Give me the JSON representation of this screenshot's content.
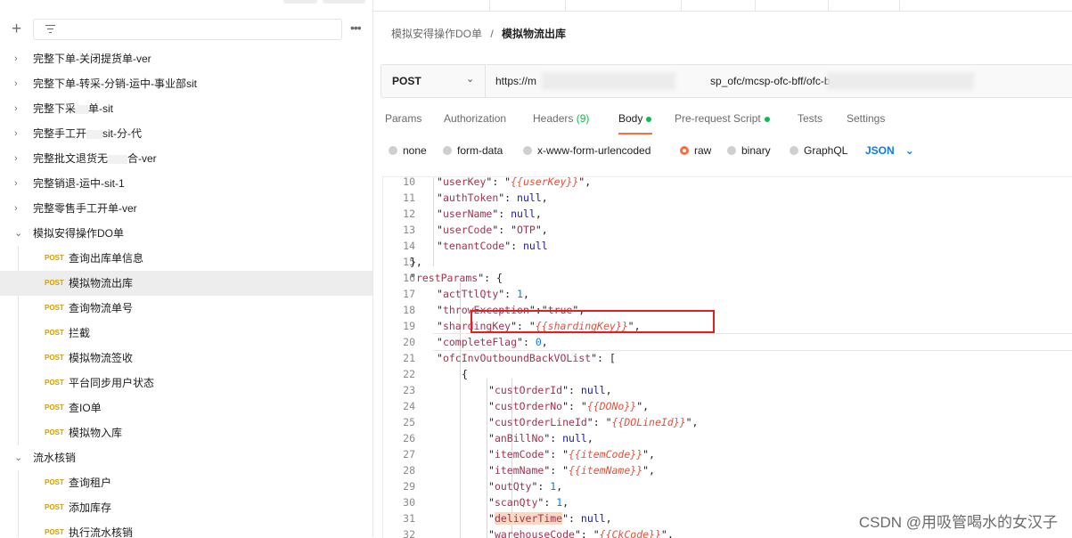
{
  "sidebar": {
    "more_label": "•••",
    "folders_top": [
      {
        "label": "完整下单-关闭提货单-ver"
      },
      {
        "label": "完整下单-转采-分销-运中-事业部sit"
      },
      {
        "label_a": "完整下采",
        "label_b": "单-sit"
      },
      {
        "label_a": "完整手工开",
        "label_b": "sit-分-代"
      },
      {
        "label_a": "完整批文退货无",
        "label_b": "合-ver"
      },
      {
        "label": "完整销退-运中-sit-1"
      },
      {
        "label": "完整零售手工开单-ver"
      }
    ],
    "open_folder": {
      "label": "模拟安得操作DO单",
      "requests": [
        {
          "method": "POST",
          "label": "查询出库单信息"
        },
        {
          "method": "POST",
          "label": "模拟物流出库"
        },
        {
          "method": "POST",
          "label": "查询物流单号"
        },
        {
          "method": "POST",
          "label": "拦截"
        },
        {
          "method": "POST",
          "label": "模拟物流签收"
        },
        {
          "method": "POST",
          "label": "平台同步用户状态"
        },
        {
          "method": "POST",
          "label": "查IO单"
        },
        {
          "method": "POST",
          "label": "模拟物入库"
        }
      ]
    },
    "open_folder2": {
      "label": "流水核销",
      "requests": [
        {
          "method": "POST",
          "label": "查询租户"
        },
        {
          "method": "POST",
          "label": "添加库存"
        },
        {
          "method": "POST",
          "label": "执行流水核销"
        }
      ]
    }
  },
  "breadcrumb": {
    "parent": "模拟安得操作DO单",
    "sep": "/",
    "current": "模拟物流出库"
  },
  "request": {
    "method": "POST",
    "url_prefix": "https://m",
    "url_mid": "sp_ofc/mcsp-ofc-bff/ofc-bff/c"
  },
  "tabs": [
    {
      "label": "Params"
    },
    {
      "label": "Authorization"
    },
    {
      "label": "Headers",
      "count": "(9)"
    },
    {
      "label": "Body"
    },
    {
      "label": "Pre-request Script"
    },
    {
      "label": "Tests"
    },
    {
      "label": "Settings"
    }
  ],
  "body_options": [
    "none",
    "form-data",
    "x-www-form-urlencoded",
    "raw",
    "binary",
    "GraphQL"
  ],
  "body_format": "JSON",
  "code_lines": [
    {
      "n": "10",
      "code": "\"userKey\": \"{{userKey}}\","
    },
    {
      "n": "11",
      "code": "\"authToken\": null,"
    },
    {
      "n": "12",
      "code": "\"userName\": null,"
    },
    {
      "n": "13",
      "code": "\"userCode\": \"OTP\","
    },
    {
      "n": "14",
      "code": "\"tenantCode\": null"
    },
    {
      "n": "15",
      "code": "},"
    },
    {
      "n": "16",
      "code": "\"restParams\": {"
    },
    {
      "n": "17",
      "code": "\"actTtlQty\": 1,"
    },
    {
      "n": "18",
      "code": "\"throwException\":\"true\","
    },
    {
      "n": "19",
      "code": "\"shardingKey\": \"{{shardingKey}}\","
    },
    {
      "n": "20",
      "code": "\"completeFlag\": 0,"
    },
    {
      "n": "21",
      "code": "\"ofcInvOutboundBackVOList\": ["
    },
    {
      "n": "22",
      "code": "{"
    },
    {
      "n": "23",
      "code": "\"custOrderId\": null,"
    },
    {
      "n": "24",
      "code": "\"custOrderNo\": \"{{DONo}}\","
    },
    {
      "n": "25",
      "code": "\"custOrderLineId\": \"{{DOLineId}}\","
    },
    {
      "n": "26",
      "code": "\"anBillNo\": null,"
    },
    {
      "n": "27",
      "code": "\"itemCode\": \"{{itemCode}}\","
    },
    {
      "n": "28",
      "code": "\"itemName\": \"{{itemName}}\","
    },
    {
      "n": "29",
      "code": "\"outQty\": 1,"
    },
    {
      "n": "30",
      "code": "\"scanQty\": 1,"
    },
    {
      "n": "31",
      "code": "\"deliverTime\": null,"
    },
    {
      "n": "32",
      "code": "\"warehouseCode\": \"{{CkCode}}\","
    }
  ],
  "watermark": "CSDN @用吸管喝水的女汉子",
  "colors": {
    "accent": "#ff6c37",
    "json_blue": "#097bed",
    "method_post": "#d69e00",
    "green_dot": "#0cbb52",
    "highlight_box": "#e02020"
  }
}
